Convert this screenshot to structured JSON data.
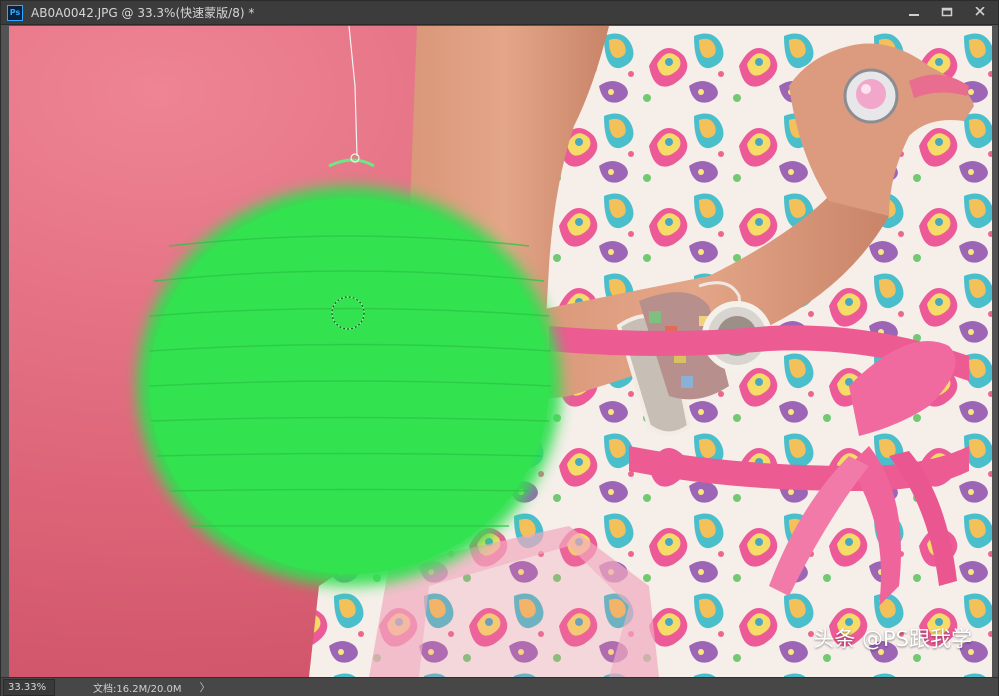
{
  "window": {
    "title": "AB0A0042.JPG @ 33.3%(快速蒙版/8) *",
    "app_icon_label": "Ps",
    "controls": [
      {
        "name": "minimize-button",
        "icon": "minimize-icon"
      },
      {
        "name": "restore-button",
        "icon": "restore-icon"
      },
      {
        "name": "close-button",
        "icon": "close-icon"
      }
    ]
  },
  "status": {
    "zoom": "33.33%",
    "doc_info": "文档:16.2M/20.0M",
    "arrow": "〉"
  },
  "watermark": "头条 @PS跟我学",
  "canvas": {
    "mode": "quick-mask",
    "background_color": "#d95e73",
    "mask_overlay_color": "#2ee04f",
    "brush_cursor": "circle"
  },
  "colors": {
    "titlebar": "#3c3c3c",
    "statusbar": "#474747",
    "workspace": "#535353"
  }
}
